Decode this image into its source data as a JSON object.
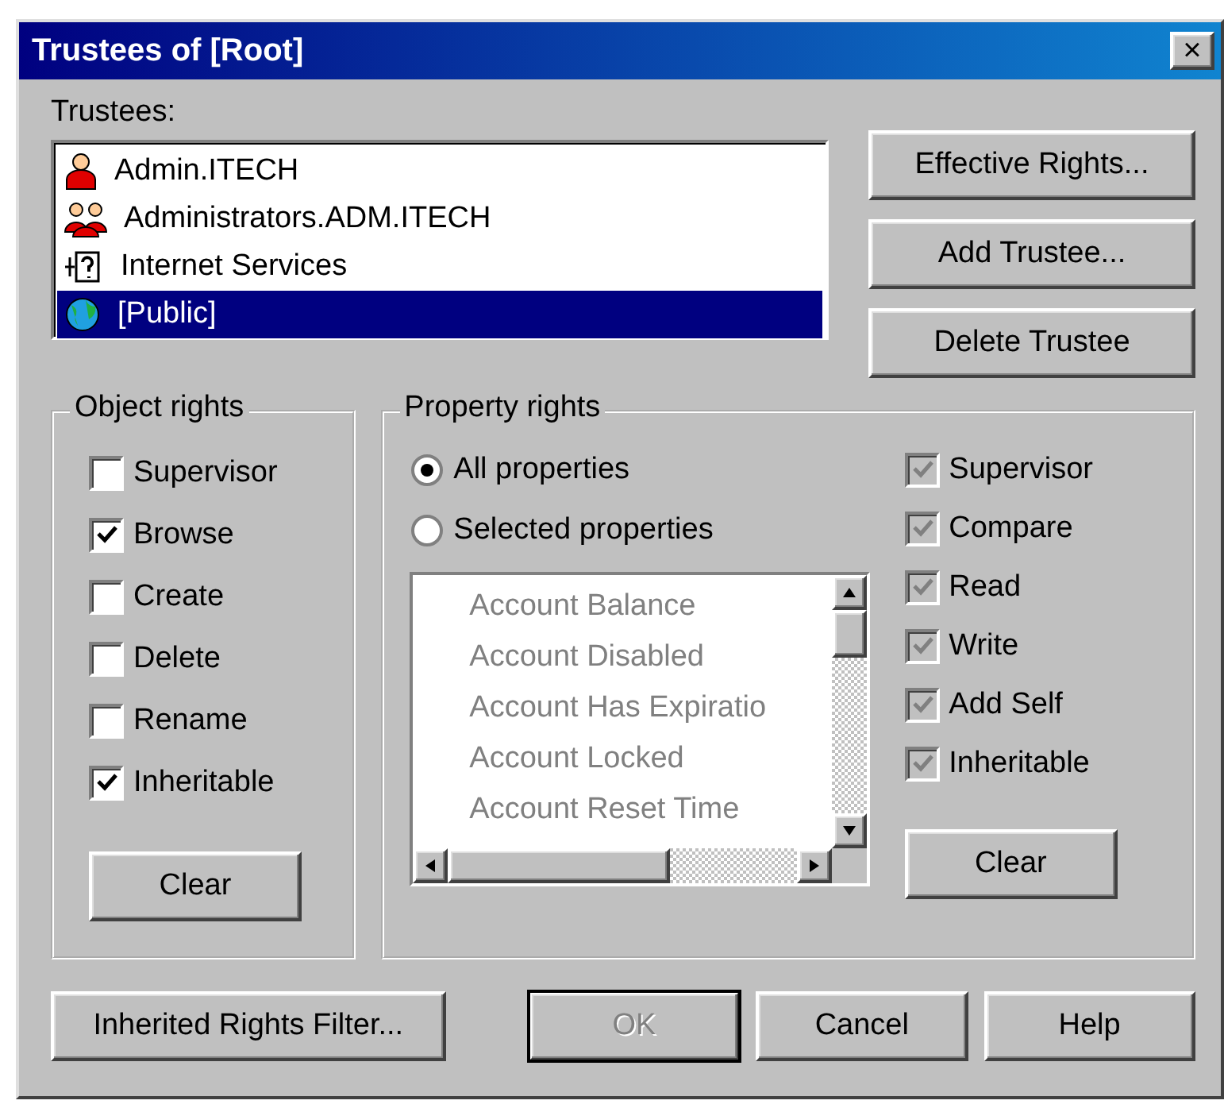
{
  "window": {
    "title": "Trustees of [Root]",
    "close": "×"
  },
  "trustees": {
    "label": "Trustees:",
    "items": [
      {
        "name": "Admin.ITECH",
        "kind": "user",
        "selected": false
      },
      {
        "name": "Administrators.ADM.ITECH",
        "kind": "group",
        "selected": false
      },
      {
        "name": "Internet Services",
        "kind": "unknown",
        "selected": false
      },
      {
        "name": "[Public]",
        "kind": "globe",
        "selected": true
      }
    ]
  },
  "side_buttons": [
    "Effective Rights...",
    "Add Trustee...",
    "Delete Trustee"
  ],
  "object_rights": {
    "title": "Object rights",
    "items": [
      {
        "label": "Supervisor",
        "checked": false
      },
      {
        "label": "Browse",
        "checked": true
      },
      {
        "label": "Create",
        "checked": false
      },
      {
        "label": "Delete",
        "checked": false
      },
      {
        "label": "Rename",
        "checked": false
      },
      {
        "label": "Inheritable",
        "checked": true
      }
    ],
    "clear": "Clear"
  },
  "property_rights": {
    "title": "Property rights",
    "scope": [
      {
        "label": "All properties",
        "selected": true
      },
      {
        "label": "Selected properties",
        "selected": false
      }
    ],
    "property_list": {
      "disabled": true,
      "items": [
        "Account Balance",
        "Account Disabled",
        "Account Has Expiratio",
        "Account Locked",
        "Account Reset Time"
      ]
    },
    "rights": [
      {
        "label": "Supervisor",
        "checked": true,
        "disabled": true
      },
      {
        "label": "Compare",
        "checked": true,
        "disabled": true
      },
      {
        "label": "Read",
        "checked": true,
        "disabled": true
      },
      {
        "label": "Write",
        "checked": true,
        "disabled": true
      },
      {
        "label": "Add Self",
        "checked": true,
        "disabled": true
      },
      {
        "label": "Inheritable",
        "checked": true,
        "disabled": true
      }
    ],
    "clear": "Clear"
  },
  "bottom_buttons": [
    {
      "label": "Inherited Rights Filter...",
      "disabled": false,
      "default": false
    },
    {
      "label": "OK",
      "disabled": true,
      "default": true
    },
    {
      "label": "Cancel",
      "disabled": false,
      "default": false
    },
    {
      "label": "Help",
      "disabled": false,
      "default": false
    }
  ]
}
